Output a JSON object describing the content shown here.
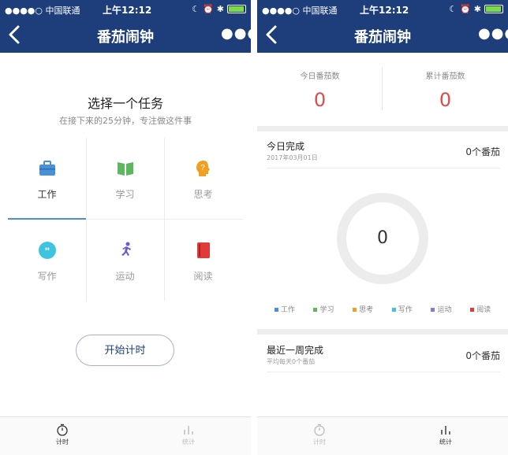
{
  "status_bar": {
    "carrier": "●●●●○ 中国联通",
    "time": "上午12:12"
  },
  "colors": {
    "header": "#1d3e7b",
    "accent_red": "#e04a4a",
    "accent_blue": "#4a90d9"
  },
  "left_screen": {
    "title": "番茄闹钟",
    "heading": "选择一个任务",
    "subheading": "在接下来的25分钟，专注做这件事",
    "tasks": [
      {
        "label": "工作",
        "icon": "briefcase-icon",
        "color": "#4a90d9",
        "selected": true
      },
      {
        "label": "学习",
        "icon": "book-icon",
        "color": "#5cb85c",
        "selected": false
      },
      {
        "label": "思考",
        "icon": "thinking-head-icon",
        "color": "#f0a020",
        "selected": false
      },
      {
        "label": "写作",
        "icon": "quote-icon",
        "color": "#3cc4e0",
        "selected": false
      },
      {
        "label": "运动",
        "icon": "running-icon",
        "color": "#6a5acd",
        "selected": false
      },
      {
        "label": "阅读",
        "icon": "red-book-icon",
        "color": "#e03a3a",
        "selected": false
      }
    ],
    "start_button": "开始计时",
    "tabs": [
      {
        "label": "计时",
        "icon": "timer-icon",
        "active": true
      },
      {
        "label": "统计",
        "icon": "bar-chart-icon",
        "active": false
      }
    ]
  },
  "right_screen": {
    "title": "番茄闹钟",
    "today_label": "今日番茄数",
    "today_value": "0",
    "total_label": "累计番茄数",
    "total_value": "0",
    "today_done_title": "今日完成",
    "today_done_date": "2017年03月01日",
    "today_done_count": "0个番茄",
    "donut_value": "0",
    "legend": [
      {
        "label": "工作",
        "color": "#4a90d9"
      },
      {
        "label": "学习",
        "color": "#5cb85c"
      },
      {
        "label": "思考",
        "color": "#f0a020"
      },
      {
        "label": "写作",
        "color": "#3cc4e0"
      },
      {
        "label": "运动",
        "color": "#8a7ad8"
      },
      {
        "label": "阅读",
        "color": "#e03a3a"
      }
    ],
    "week_title": "最近一周完成",
    "week_sub": "平均每天0个番茄",
    "week_count": "0个番茄",
    "tabs": [
      {
        "label": "计时",
        "icon": "timer-icon",
        "active": false
      },
      {
        "label": "统计",
        "icon": "bar-chart-icon",
        "active": true
      }
    ]
  }
}
